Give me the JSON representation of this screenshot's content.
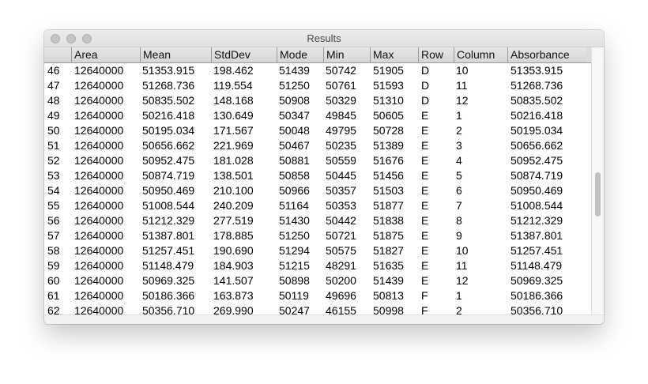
{
  "window": {
    "title": "Results"
  },
  "table": {
    "columns": [
      "",
      "Area",
      "Mean",
      "StdDev",
      "Mode",
      "Min",
      "Max",
      "Row",
      "Column",
      "Absorbance"
    ],
    "rows": [
      [
        "46",
        "12640000",
        "51353.915",
        "198.462",
        "51439",
        "50742",
        "51905",
        "D",
        "10",
        "51353.915"
      ],
      [
        "47",
        "12640000",
        "51268.736",
        "119.554",
        "51250",
        "50761",
        "51593",
        "D",
        "11",
        "51268.736"
      ],
      [
        "48",
        "12640000",
        "50835.502",
        "148.168",
        "50908",
        "50329",
        "51310",
        "D",
        "12",
        "50835.502"
      ],
      [
        "49",
        "12640000",
        "50216.418",
        "130.649",
        "50347",
        "49845",
        "50605",
        "E",
        "1",
        "50216.418"
      ],
      [
        "50",
        "12640000",
        "50195.034",
        "171.567",
        "50048",
        "49795",
        "50728",
        "E",
        "2",
        "50195.034"
      ],
      [
        "51",
        "12640000",
        "50656.662",
        "221.969",
        "50467",
        "50235",
        "51389",
        "E",
        "3",
        "50656.662"
      ],
      [
        "52",
        "12640000",
        "50952.475",
        "181.028",
        "50881",
        "50559",
        "51676",
        "E",
        "4",
        "50952.475"
      ],
      [
        "53",
        "12640000",
        "50874.719",
        "138.501",
        "50858",
        "50445",
        "51456",
        "E",
        "5",
        "50874.719"
      ],
      [
        "54",
        "12640000",
        "50950.469",
        "210.100",
        "50966",
        "50357",
        "51503",
        "E",
        "6",
        "50950.469"
      ],
      [
        "55",
        "12640000",
        "51008.544",
        "240.209",
        "51164",
        "50353",
        "51877",
        "E",
        "7",
        "51008.544"
      ],
      [
        "56",
        "12640000",
        "51212.329",
        "277.519",
        "51430",
        "50442",
        "51838",
        "E",
        "8",
        "51212.329"
      ],
      [
        "57",
        "12640000",
        "51387.801",
        "178.885",
        "51250",
        "50721",
        "51875",
        "E",
        "9",
        "51387.801"
      ],
      [
        "58",
        "12640000",
        "51257.451",
        "190.690",
        "51294",
        "50575",
        "51827",
        "E",
        "10",
        "51257.451"
      ],
      [
        "59",
        "12640000",
        "51148.479",
        "184.903",
        "51215",
        "48291",
        "51635",
        "E",
        "11",
        "51148.479"
      ],
      [
        "60",
        "12640000",
        "50969.325",
        "141.507",
        "50898",
        "50200",
        "51439",
        "E",
        "12",
        "50969.325"
      ],
      [
        "61",
        "12640000",
        "50186.366",
        "163.873",
        "50119",
        "49696",
        "50813",
        "F",
        "1",
        "50186.366"
      ],
      [
        "62",
        "12640000",
        "50356.710",
        "269.990",
        "50247",
        "46155",
        "50998",
        "F",
        "2",
        "50356.710"
      ]
    ]
  }
}
